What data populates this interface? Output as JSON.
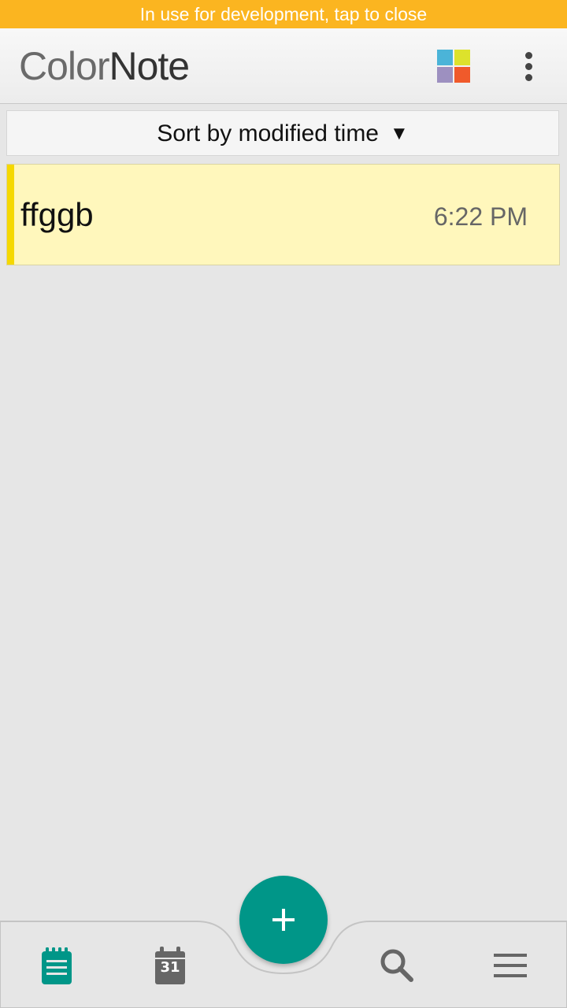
{
  "status_banner": {
    "text": "In use for development, tap to close"
  },
  "app_bar": {
    "logo_part1": "Color",
    "logo_part2": "Note",
    "color_filter_colors": [
      "#4bb4d8",
      "#dde22c",
      "#9d90c0",
      "#f05a2b"
    ],
    "overflow_icon": "more-vert-icon"
  },
  "sort": {
    "label": "Sort by modified time",
    "arrow": "▼"
  },
  "notes": [
    {
      "title": "ffggb",
      "time": "6:22 PM",
      "color": "#f5d800"
    }
  ],
  "bottom_nav": {
    "items": [
      {
        "icon": "notes-icon",
        "active": true
      },
      {
        "icon": "calendar-icon",
        "day": "31"
      },
      {
        "icon": "search-icon"
      },
      {
        "icon": "menu-icon"
      }
    ],
    "fab_icon": "plus-icon"
  },
  "colors": {
    "accent": "#009688",
    "banner": "#fbb520",
    "icon_gray": "#666666"
  }
}
